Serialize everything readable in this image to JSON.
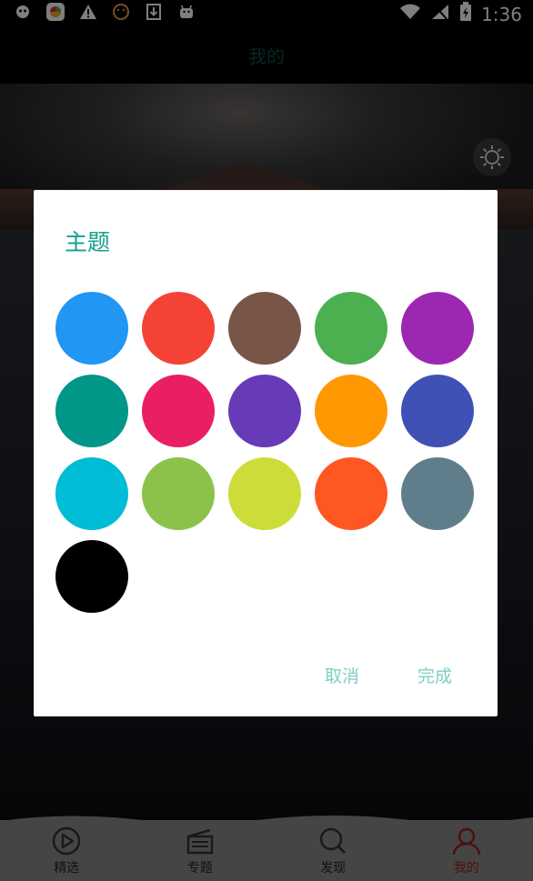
{
  "status_bar": {
    "time": "1:36",
    "left_icons": [
      "baby-icon",
      "app-store-icon",
      "warning-icon",
      "emoji-icon",
      "download-icon",
      "android-icon"
    ],
    "right_icons": [
      "wifi-icon",
      "signal-off-icon",
      "battery-charging-icon"
    ]
  },
  "app_bar": {
    "title": "我的"
  },
  "dialog": {
    "title": "主题",
    "swatches": [
      {
        "color": "#2196F3"
      },
      {
        "color": "#F44336"
      },
      {
        "color": "#795548"
      },
      {
        "color": "#4CAF50"
      },
      {
        "color": "#9C27B0"
      },
      {
        "color": "#009688"
      },
      {
        "color": "#E91E63"
      },
      {
        "color": "#673AB7"
      },
      {
        "color": "#FF9800"
      },
      {
        "color": "#3F51B5"
      },
      {
        "color": "#00BCD4"
      },
      {
        "color": "#8BC34A"
      },
      {
        "color": "#CDDC39"
      },
      {
        "color": "#FF5722"
      },
      {
        "color": "#607D8B"
      },
      {
        "color": "#000000"
      }
    ],
    "cancel_label": "取消",
    "confirm_label": "完成"
  },
  "bottom_nav": {
    "items": [
      {
        "label": "精选",
        "icon": "play-circle-icon"
      },
      {
        "label": "专题",
        "icon": "clapperboard-icon"
      },
      {
        "label": "发现",
        "icon": "search-icon"
      },
      {
        "label": "我的",
        "icon": "person-icon",
        "active": true
      }
    ]
  }
}
